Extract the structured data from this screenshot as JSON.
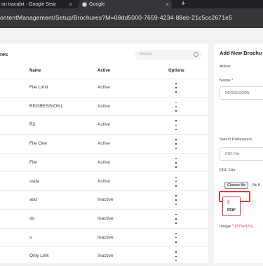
{
  "browser": {
    "tabs": [
      {
        "title": "on tracabit · Google Sear"
      },
      {
        "title": "Google"
      }
    ],
    "new_tab_glyph": "+",
    "close_glyph": "×",
    "url": "ontentManagement/Setup/Brochures?M=08dd5000-7659-4234-88eb-21c5cc2671e5"
  },
  "table_card": {
    "title": "res",
    "search_placeholder": "Search",
    "columns": {
      "name": "Name",
      "active": "Active",
      "options": "Options"
    },
    "rows": [
      {
        "name": "File Limit",
        "active": "Active"
      },
      {
        "name": "REGRESSION1",
        "active": "Active"
      },
      {
        "name": "R2",
        "active": "Active"
      },
      {
        "name": "File One",
        "active": "Active"
      },
      {
        "name": "File",
        "active": "Active"
      },
      {
        "name": "ssda",
        "active": "Active"
      },
      {
        "name": "asd",
        "active": "Inactive"
      },
      {
        "name": "ds",
        "active": "Inactive"
      },
      {
        "name": "s",
        "active": "Inactive"
      },
      {
        "name": "Only Link",
        "active": "Inactive"
      }
    ]
  },
  "form": {
    "title": "Add New Brochu",
    "active_label": "Active",
    "name_label": "Name",
    "required_mark": "*",
    "name_value": "REGRESSION",
    "preference_label": "Select Preference",
    "preference_value": "PDF File",
    "pdf_label": "PDF File",
    "choose_button": "Choose file",
    "no_file": "No fi",
    "pdf_icon_text": "PDF",
    "image_label": "Image",
    "image_hint": "(375x375)"
  },
  "colors": {
    "accent_red": "#e53935",
    "chrome_dark": "#202124",
    "url_bar": "#35363a"
  }
}
